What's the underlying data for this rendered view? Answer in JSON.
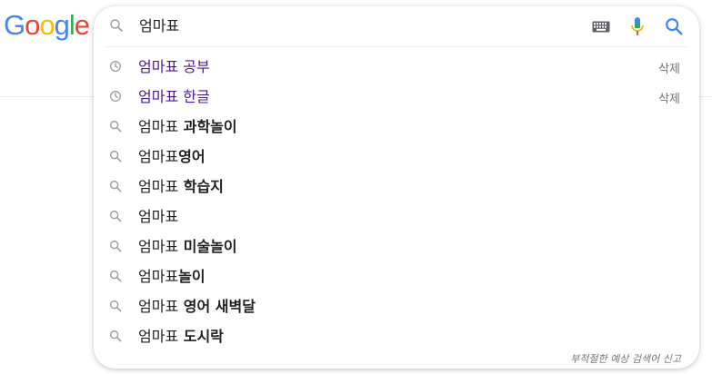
{
  "logo": {
    "letters": [
      "G",
      "o",
      "o",
      "g",
      "l",
      "e"
    ],
    "colors": [
      "#4285f4",
      "#ea4335",
      "#fbbc05",
      "#4285f4",
      "#34a853",
      "#ea4335"
    ]
  },
  "search": {
    "query": "엄마표"
  },
  "suggestions": [
    {
      "type": "history",
      "base": "엄마표",
      "tail": " 공부",
      "delete_label": "삭제"
    },
    {
      "type": "history",
      "base": "엄마표",
      "tail": " 한글",
      "delete_label": "삭제"
    },
    {
      "type": "search",
      "base": "엄마표",
      "tail": " 과학놀이"
    },
    {
      "type": "search",
      "base": "엄마표",
      "tail": "영어"
    },
    {
      "type": "search",
      "base": "엄마표",
      "tail": " 학습지"
    },
    {
      "type": "search",
      "base": "엄마표",
      "tail": ""
    },
    {
      "type": "search",
      "base": "엄마표",
      "tail": " 미술놀이"
    },
    {
      "type": "search",
      "base": "엄마표",
      "tail": "놀이"
    },
    {
      "type": "search",
      "base": "엄마표",
      "tail": " 영어 새벽달"
    },
    {
      "type": "search",
      "base": "엄마표",
      "tail": " 도시락"
    }
  ],
  "report_link": "부적절한 예상 검색어 신고",
  "colors": {
    "accent": "#4285f4",
    "history_text": "#52188c",
    "icon_gray": "#9aa0a6"
  }
}
